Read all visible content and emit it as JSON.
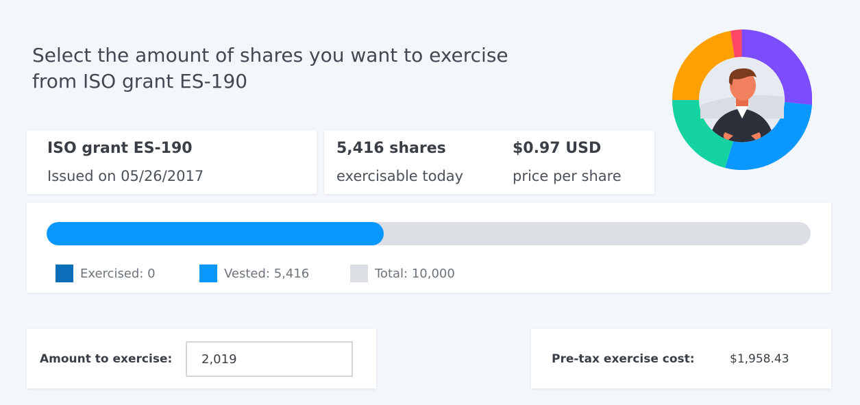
{
  "header": {
    "title_line1": "Select the amount of shares you want to exercise",
    "title_line2": "from ISO grant ES-190"
  },
  "grant": {
    "name": "ISO grant ES-190",
    "issued": "Issued on 05/26/2017"
  },
  "shares": {
    "count": "5,416 shares",
    "count_caption": "exercisable today",
    "price": "$0.97 USD",
    "price_caption": "price per share"
  },
  "progress": {
    "vested_fraction": 0.4416,
    "exercised_fraction": 0.0,
    "legend": [
      {
        "label": "Exercised: 0",
        "color": "#0a6fb8"
      },
      {
        "label": "Vested: 5,416",
        "color": "#0a98ff"
      },
      {
        "label": "Total: 10,000",
        "color": "#dcdfe4"
      }
    ]
  },
  "amount": {
    "label": "Amount to exercise:",
    "value": "2,019"
  },
  "cost": {
    "label": "Pre-tax exercise cost:",
    "value": "$1,958.43"
  },
  "avatar": {
    "icon": "user-avatar-icon",
    "ring_colors": [
      "#7b4dff",
      "#0a98ff",
      "#14d3a0",
      "#ff9f00",
      "#ff4766"
    ]
  }
}
